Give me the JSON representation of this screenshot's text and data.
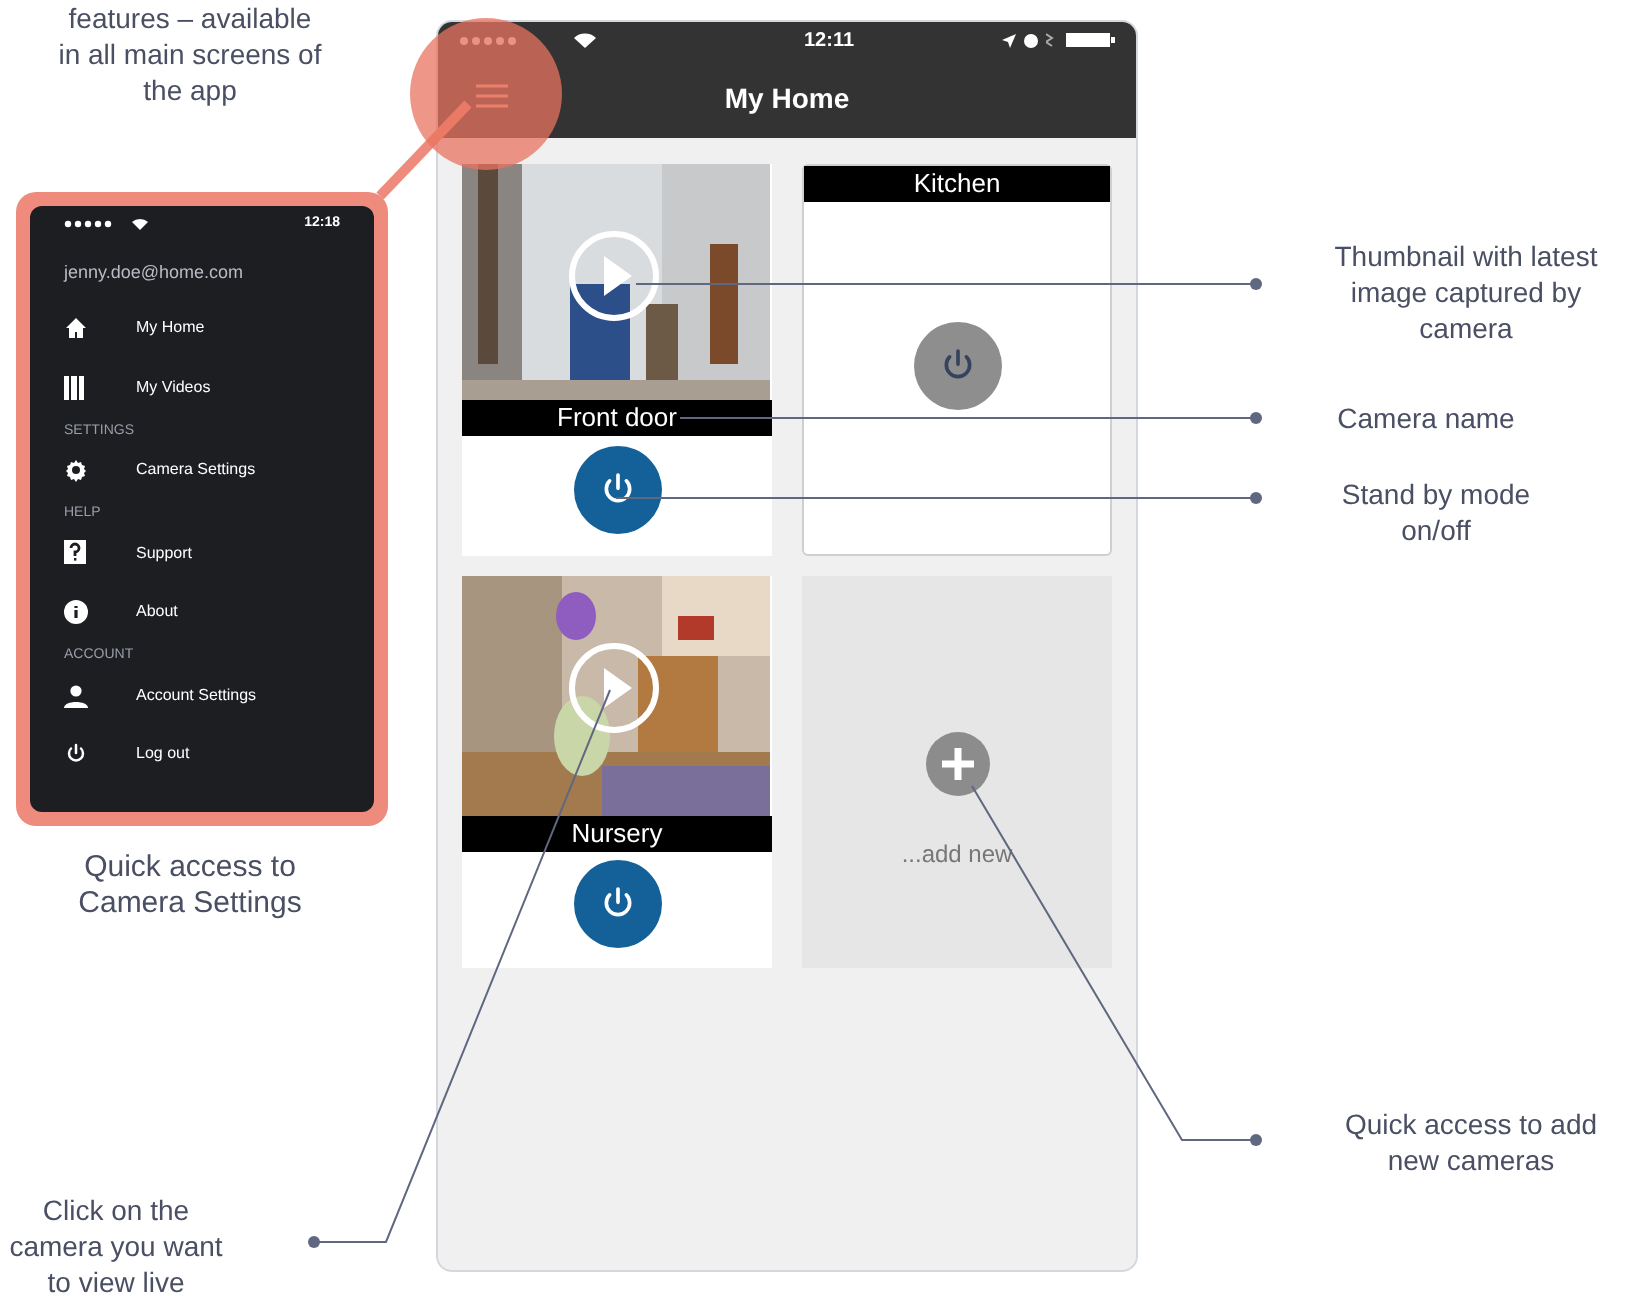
{
  "notes": {
    "top": "features – available\nin all main screens of\nthe app",
    "menu": "Quick access to\nCamera Settings",
    "click": "Click on the\ncamera you want\nto view live"
  },
  "side_menu": {
    "time": "12:18",
    "email": "jenny.doe@home.com",
    "items": [
      {
        "kind": "item",
        "label": "My Home"
      },
      {
        "kind": "item",
        "label": "My Videos"
      },
      {
        "kind": "section",
        "label": "SETTINGS"
      },
      {
        "kind": "item",
        "label": "Camera Settings"
      },
      {
        "kind": "section",
        "label": "HELP"
      },
      {
        "kind": "item",
        "label": "Support"
      },
      {
        "kind": "item",
        "label": "About"
      },
      {
        "kind": "section",
        "label": "ACCOUNT"
      },
      {
        "kind": "item",
        "label": "Account Settings"
      },
      {
        "kind": "item",
        "label": "Log out"
      }
    ]
  },
  "phone": {
    "time": "12:11",
    "title": "My Home",
    "cameras": [
      {
        "kind": "live",
        "name": "Front door",
        "on": true
      },
      {
        "kind": "no_image",
        "name": "Kitchen",
        "on": false
      },
      {
        "kind": "live",
        "name": "Nursery",
        "on": true
      },
      {
        "kind": "add",
        "name": "...add new"
      }
    ]
  },
  "callouts": [
    "Thumbnail with latest\nimage captured by\ncamera",
    "Camera name",
    "Stand by mode\non/off",
    "Quick access to add\nnew cameras"
  ]
}
